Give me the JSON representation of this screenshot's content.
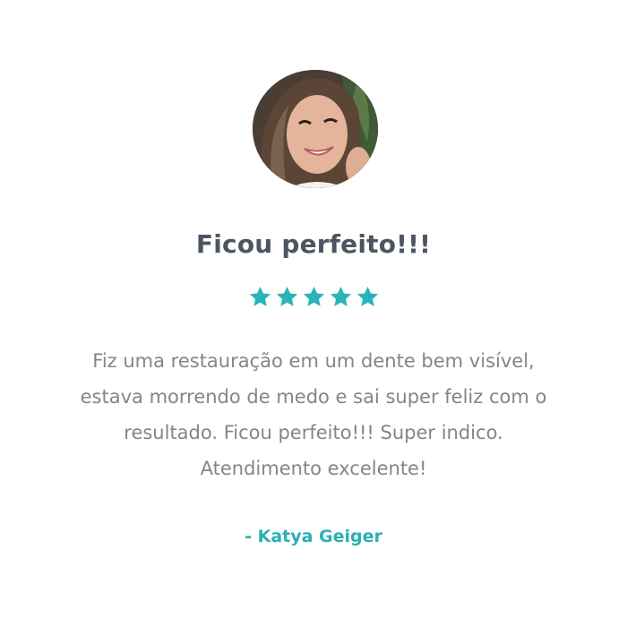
{
  "testimonial": {
    "title": "Ficou perfeito!!!",
    "rating": 5,
    "rating_max": 5,
    "review_text": "Fiz uma restauração em um dente bem visível, estava morrendo de medo e sai super feliz com o resultado. Ficou perfeito!!! Super indico. Atendimento excelente!",
    "author": "- Katya Geiger",
    "avatar_icon": "user-avatar-photo",
    "star_icon": "star-icon"
  },
  "colors": {
    "accent": "#2ab0b3",
    "title": "#4d5563",
    "body_text": "#858585",
    "star": "#2ab4b8"
  }
}
